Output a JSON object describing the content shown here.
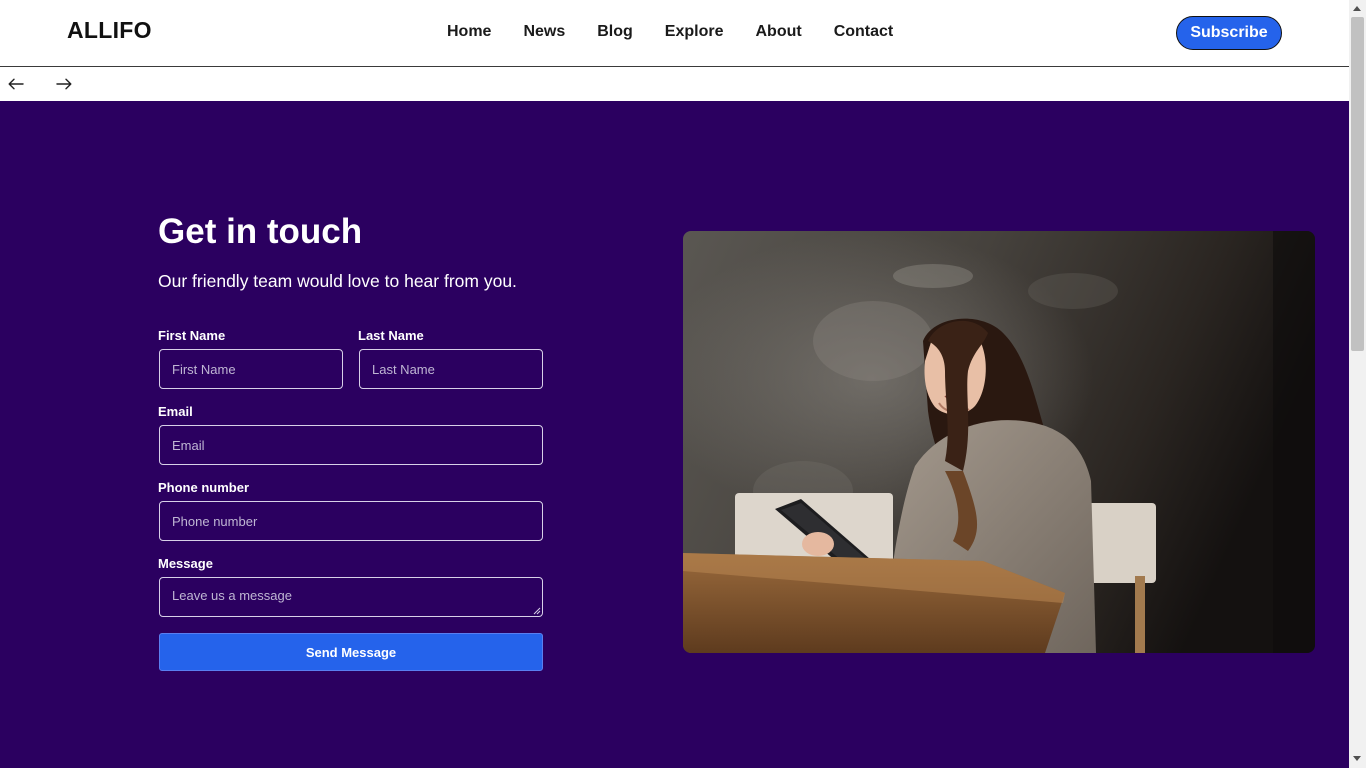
{
  "header": {
    "logo": "ALLIFO",
    "nav": [
      "Home",
      "News",
      "Blog",
      "Explore",
      "About",
      "Contact"
    ],
    "subscribe_label": "Subscribe"
  },
  "arrows": {
    "back_icon": "arrow-left-icon",
    "forward_icon": "arrow-right-icon"
  },
  "contact": {
    "title": "Get in touch",
    "subtitle": "Our friendly team would love to hear from you.",
    "fields": {
      "first_name": {
        "label": "First Name",
        "placeholder": "First Name",
        "value": ""
      },
      "last_name": {
        "label": "Last Name",
        "placeholder": "Last Name",
        "value": ""
      },
      "email": {
        "label": "Email",
        "placeholder": "Email",
        "value": ""
      },
      "phone": {
        "label": "Phone number",
        "placeholder": "Phone number",
        "value": ""
      },
      "message": {
        "label": "Message",
        "placeholder": "Leave us a message",
        "value": ""
      }
    },
    "submit_label": "Send Message"
  },
  "colors": {
    "accent": "#2563eb",
    "section_bg": "#2b0060",
    "text_on_dark": "#ffffff"
  }
}
